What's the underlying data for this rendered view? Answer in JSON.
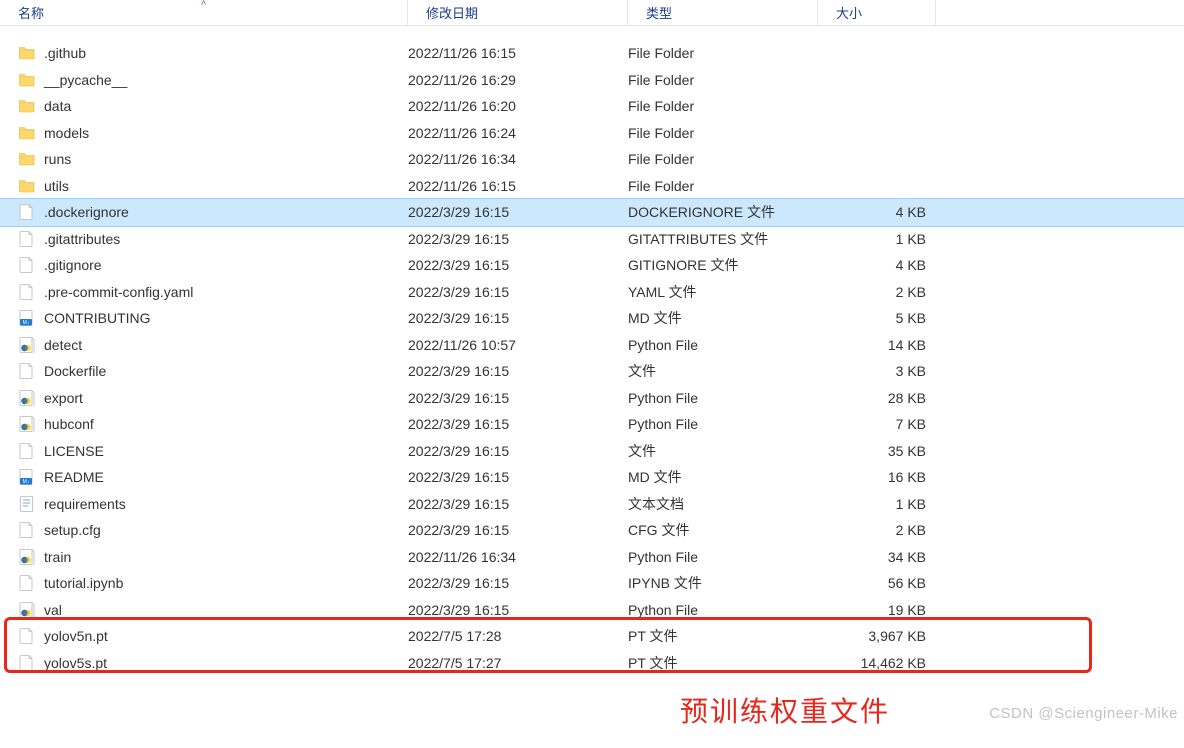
{
  "columns": {
    "name": "名称",
    "date": "修改日期",
    "type": "类型",
    "size": "大小"
  },
  "rows": [
    {
      "icon": "folder",
      "name": ".github",
      "date": "2022/11/26 16:15",
      "type": "File Folder",
      "size": "",
      "selected": false
    },
    {
      "icon": "folder",
      "name": "__pycache__",
      "date": "2022/11/26 16:29",
      "type": "File Folder",
      "size": "",
      "selected": false
    },
    {
      "icon": "folder",
      "name": "data",
      "date": "2022/11/26 16:20",
      "type": "File Folder",
      "size": "",
      "selected": false
    },
    {
      "icon": "folder",
      "name": "models",
      "date": "2022/11/26 16:24",
      "type": "File Folder",
      "size": "",
      "selected": false
    },
    {
      "icon": "folder",
      "name": "runs",
      "date": "2022/11/26 16:34",
      "type": "File Folder",
      "size": "",
      "selected": false
    },
    {
      "icon": "folder",
      "name": "utils",
      "date": "2022/11/26 16:15",
      "type": "File Folder",
      "size": "",
      "selected": false
    },
    {
      "icon": "file",
      "name": ".dockerignore",
      "date": "2022/3/29 16:15",
      "type": "DOCKERIGNORE 文件",
      "size": "4 KB",
      "selected": true
    },
    {
      "icon": "file",
      "name": ".gitattributes",
      "date": "2022/3/29 16:15",
      "type": "GITATTRIBUTES 文件",
      "size": "1 KB",
      "selected": false
    },
    {
      "icon": "file",
      "name": ".gitignore",
      "date": "2022/3/29 16:15",
      "type": "GITIGNORE 文件",
      "size": "4 KB",
      "selected": false
    },
    {
      "icon": "file",
      "name": ".pre-commit-config.yaml",
      "date": "2022/3/29 16:15",
      "type": "YAML 文件",
      "size": "2 KB",
      "selected": false
    },
    {
      "icon": "md",
      "name": "CONTRIBUTING",
      "date": "2022/3/29 16:15",
      "type": "MD 文件",
      "size": "5 KB",
      "selected": false
    },
    {
      "icon": "python",
      "name": "detect",
      "date": "2022/11/26 10:57",
      "type": "Python File",
      "size": "14 KB",
      "selected": false
    },
    {
      "icon": "file",
      "name": "Dockerfile",
      "date": "2022/3/29 16:15",
      "type": "文件",
      "size": "3 KB",
      "selected": false
    },
    {
      "icon": "python",
      "name": "export",
      "date": "2022/3/29 16:15",
      "type": "Python File",
      "size": "28 KB",
      "selected": false
    },
    {
      "icon": "python",
      "name": "hubconf",
      "date": "2022/3/29 16:15",
      "type": "Python File",
      "size": "7 KB",
      "selected": false
    },
    {
      "icon": "file",
      "name": "LICENSE",
      "date": "2022/3/29 16:15",
      "type": "文件",
      "size": "35 KB",
      "selected": false
    },
    {
      "icon": "md",
      "name": "README",
      "date": "2022/3/29 16:15",
      "type": "MD 文件",
      "size": "16 KB",
      "selected": false
    },
    {
      "icon": "text",
      "name": "requirements",
      "date": "2022/3/29 16:15",
      "type": "文本文档",
      "size": "1 KB",
      "selected": false
    },
    {
      "icon": "file",
      "name": "setup.cfg",
      "date": "2022/3/29 16:15",
      "type": "CFG 文件",
      "size": "2 KB",
      "selected": false
    },
    {
      "icon": "python",
      "name": "train",
      "date": "2022/11/26 16:34",
      "type": "Python File",
      "size": "34 KB",
      "selected": false
    },
    {
      "icon": "file",
      "name": "tutorial.ipynb",
      "date": "2022/3/29 16:15",
      "type": "IPYNB 文件",
      "size": "56 KB",
      "selected": false
    },
    {
      "icon": "python",
      "name": "val",
      "date": "2022/3/29 16:15",
      "type": "Python File",
      "size": "19 KB",
      "selected": false
    },
    {
      "icon": "file",
      "name": "yolov5n.pt",
      "date": "2022/7/5 17:28",
      "type": "PT 文件",
      "size": "3,967 KB",
      "selected": false
    },
    {
      "icon": "file",
      "name": "yolov5s.pt",
      "date": "2022/7/5 17:27",
      "type": "PT 文件",
      "size": "14,462 KB",
      "selected": false
    }
  ],
  "annotation": "预训练权重文件",
  "watermark": "CSDN @Sciengineer-Mike"
}
